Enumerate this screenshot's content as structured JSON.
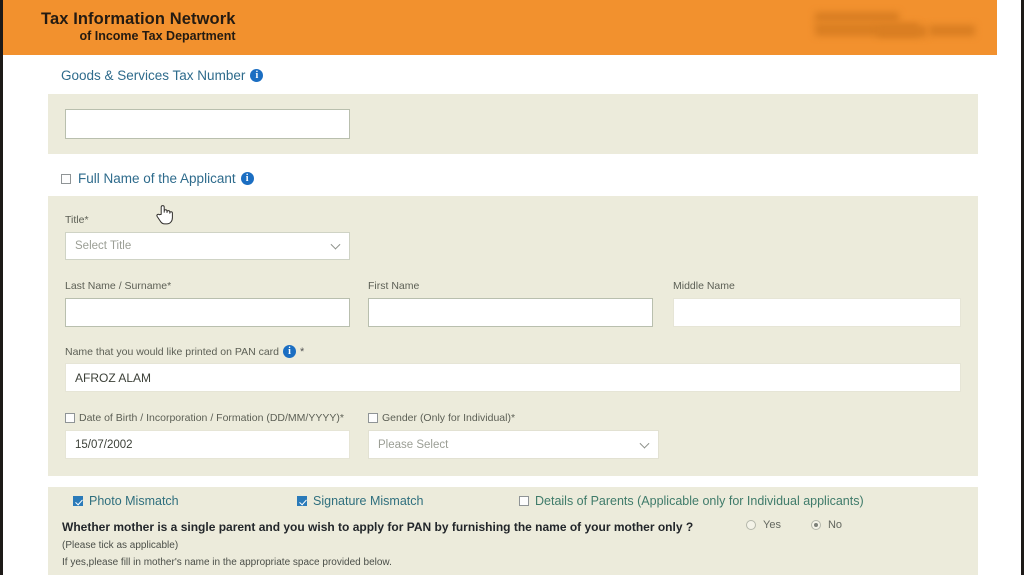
{
  "header": {
    "brand_line1": "Tax Information Network",
    "brand_line2": "of Income Tax Department",
    "redacted_logo": "blurred-logo",
    "background_color": "#f2912e"
  },
  "sections": {
    "gst": {
      "title": "Goods & Services Tax Number",
      "info_icon": "info-icon",
      "input_value": "",
      "input_placeholder": ""
    },
    "full_name": {
      "title": "Full Name of the Applicant",
      "checkbox_checked": false,
      "info_icon": "info-icon",
      "title_label": "Title*",
      "title_select_value": "Select Title",
      "last_name_label": "Last Name / Surname*",
      "last_name_value": "",
      "first_name_label": "First Name",
      "first_name_value": "",
      "middle_name_label": "Middle Name",
      "middle_name_value": "",
      "pan_name_label": "Name that you would like printed on PAN card",
      "pan_name_required": "*",
      "pan_name_value": "AFROZ ALAM",
      "dob_label": "Date of Birth / Incorporation / Formation (DD/MM/YYYY)*",
      "dob_checkbox_checked": false,
      "dob_value": "15/07/2002",
      "gender_label": "Gender (Only for Individual)*",
      "gender_checkbox_checked": false,
      "gender_select_value": "Please Select"
    },
    "mismatch": {
      "photo_mismatch_label": "Photo Mismatch",
      "photo_mismatch_checked": true,
      "signature_mismatch_label": "Signature Mismatch",
      "signature_mismatch_checked": true,
      "details_of_parents_label": "Details of Parents (Applicable only for Individual applicants)",
      "details_of_parents_checked": false,
      "question": "Whether mother is a single parent and you wish to apply for PAN by furnishing the name of your mother only ?",
      "note1": "(Please tick as applicable)",
      "note2": "If yes,please fill in mother's name in the appropriate space provided below.",
      "yes_label": "Yes",
      "no_label": "No",
      "selected": "No"
    }
  },
  "cursor": {
    "type": "pointing-hand-cursor"
  },
  "colors": {
    "header_orange": "#f2912e",
    "panel_beige": "#ecebdb",
    "link_blue": "#2e6b8c",
    "checkbox_blue": "#2a7ab9",
    "info_blue": "#1b6ec2"
  }
}
